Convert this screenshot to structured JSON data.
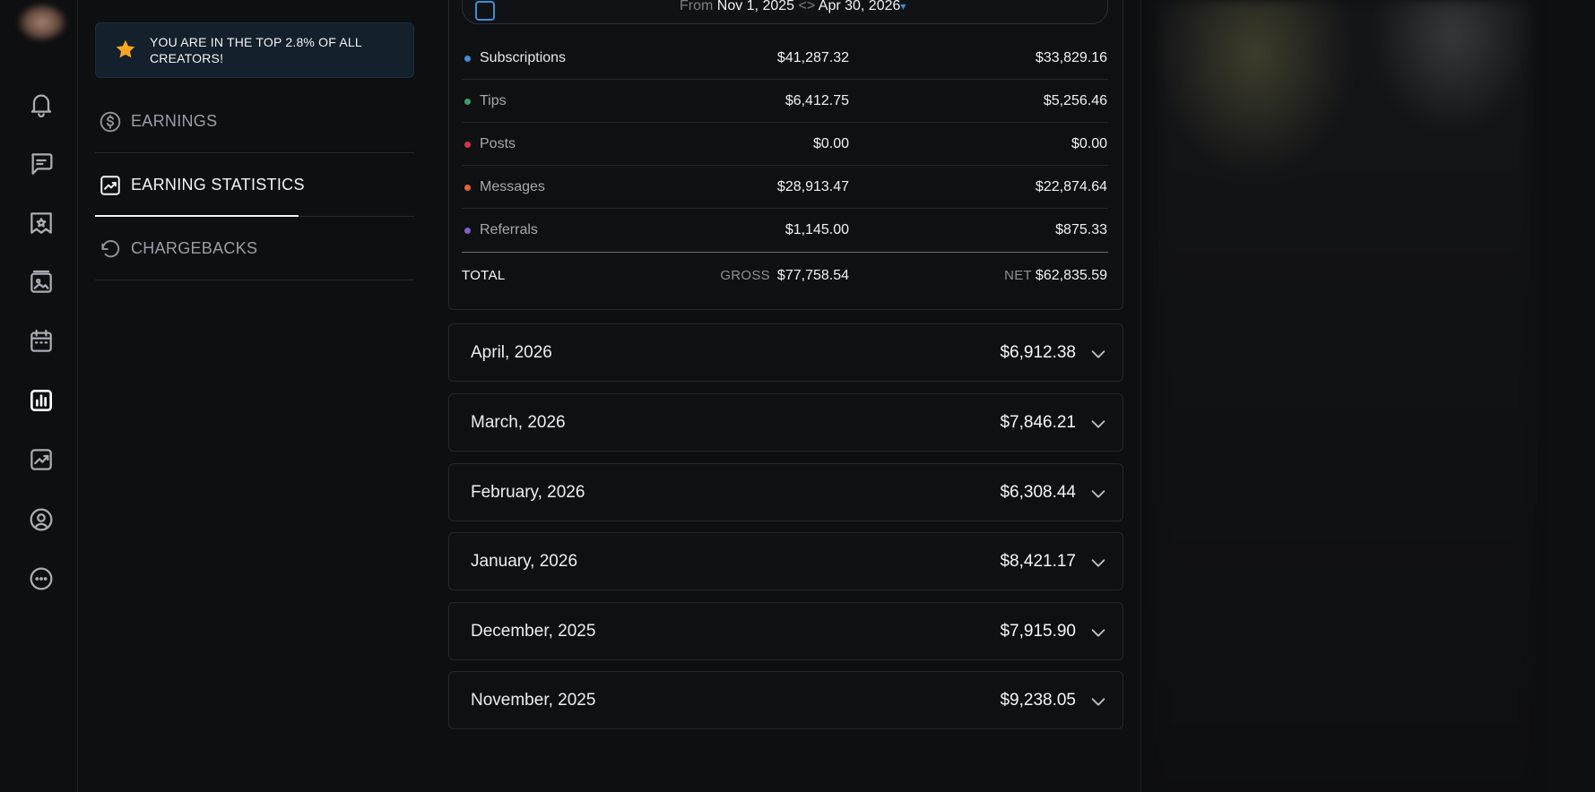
{
  "banner": {
    "text": "YOU ARE IN THE TOP 2.8% OF ALL CREATORS!",
    "icon": "star-icon",
    "star_color": "#f5a623"
  },
  "menu": {
    "items": [
      {
        "label": "EARNINGS",
        "icon": "dollar-circle-icon"
      },
      {
        "label": "EARNING STATISTICS",
        "icon": "chart-trend-icon",
        "active": true
      },
      {
        "label": "CHARGEBACKS",
        "icon": "undo-icon"
      }
    ]
  },
  "rail": {
    "icons": [
      "bell-icon",
      "message-icon",
      "collections-icon",
      "vault-icon",
      "calendar-icon",
      "statistics-icon",
      "analytics-icon",
      "profile-icon",
      "more-icon"
    ],
    "active": "statistics-icon"
  },
  "date_range": {
    "from_label": "From",
    "from": "Nov 1, 2025",
    "to": "Apr 30, 2026"
  },
  "summary": {
    "rows": [
      {
        "name": "Subscriptions",
        "gross": "$41,287.32",
        "net": "$33,829.16",
        "color": "#3a8fd9"
      },
      {
        "name": "Tips",
        "gross": "$6,412.75",
        "net": "$5,256.46",
        "color": "#3b9c6e"
      },
      {
        "name": "Posts",
        "gross": "$0.00",
        "net": "$0.00",
        "color": "#d2334d"
      },
      {
        "name": "Messages",
        "gross": "$28,913.47",
        "net": "$22,874.64",
        "color": "#e4613a"
      },
      {
        "name": "Referrals",
        "gross": "$1,145.00",
        "net": "$875.33",
        "color": "#7d62c9"
      }
    ],
    "total": {
      "label": "TOTAL",
      "gross_label": "GROSS",
      "gross": "$77,758.54",
      "net_label": "NET",
      "net": "$62,835.59"
    }
  },
  "months": [
    {
      "name": "April, 2026",
      "amount": "$6,912.38"
    },
    {
      "name": "March, 2026",
      "amount": "$7,846.21"
    },
    {
      "name": "February, 2026",
      "amount": "$6,308.44"
    },
    {
      "name": "January, 2026",
      "amount": "$8,421.17"
    },
    {
      "name": "December, 2025",
      "amount": "$7,915.90"
    },
    {
      "name": "November, 2025",
      "amount": "$9,238.05"
    }
  ]
}
